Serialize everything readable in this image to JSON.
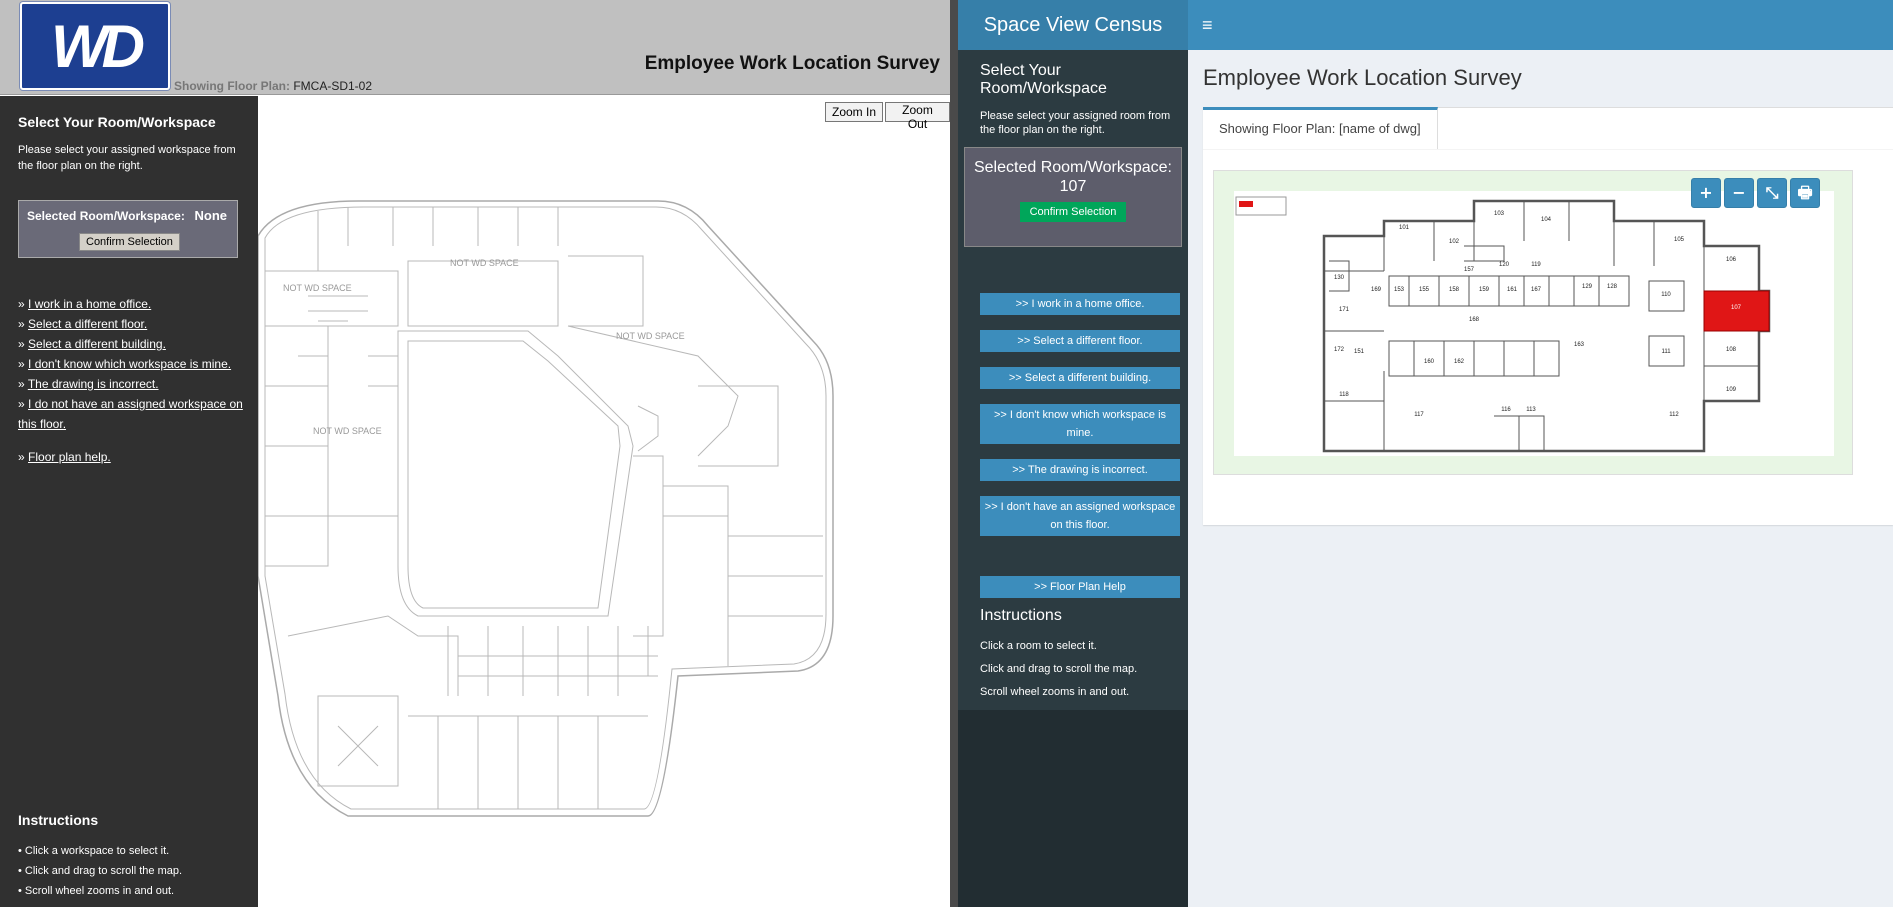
{
  "left": {
    "logo_text": "WD",
    "showing_label": "Showing Floor Plan:",
    "floor_plan_name": "FMCA-SD1-02",
    "title": "Employee Work Location Survey",
    "sidebar": {
      "heading": "Select Your Room/Workspace",
      "instruction": "Please select your assigned workspace from the floor plan on the right.",
      "selected_label": "Selected Room/Workspace:",
      "selected_value": "None",
      "confirm_label": "Confirm Selection",
      "bullet": "»",
      "links": [
        "I work in a home office.",
        "Select a different floor.",
        "Select a different building.",
        "I don't know which workspace is mine.",
        "The drawing is incorrect.",
        "I do not have an assigned workspace on this floor."
      ],
      "help_link": "Floor plan help.",
      "instructions_title": "Instructions",
      "instructions": [
        "• Click a workspace to select it.",
        "• Click and drag to scroll the map.",
        "• Scroll wheel zooms in and out."
      ]
    },
    "map": {
      "zoom_in_label": "Zoom In",
      "zoom_out_label": "Zoom Out",
      "space_labels": [
        "NOT WD SPACE",
        "NOT WD SPACE",
        "NOT WD SPACE",
        "NOT WD SPACE"
      ]
    }
  },
  "right": {
    "brand": "Space View Census",
    "menu_icon": "≡",
    "sidebar": {
      "heading": "Select Your Room/Workspace",
      "instruction": "Please select your assigned room from the floor plan on the right.",
      "selected_text": "Selected Room/Workspace: 107",
      "confirm_label": "Confirm Selection",
      "buttons": [
        ">> I work in a home office.",
        ">> Select a different floor.",
        ">> Select a different building.",
        ">> I don't know which workspace is mine.",
        ">> The drawing is incorrect.",
        ">> I don't have an assigned workspace on this floor."
      ],
      "help_button": ">> Floor Plan Help",
      "instructions_title": "Instructions",
      "instructions": [
        "Click a room to select it.",
        "Click and drag to scroll the map.",
        "Scroll wheel zooms in and out."
      ]
    },
    "page_title": "Employee Work Location Survey",
    "tab_label": "Showing Floor Plan: [name of dwg]",
    "map_controls": {
      "zoom_in_icon": "+",
      "zoom_out_icon": "−",
      "fit_icon": "⤡",
      "print_icon": "🖶"
    },
    "selected_room": "107",
    "highlight_color": "#e01616",
    "room_labels": [
      "101",
      "102",
      "103",
      "104",
      "105",
      "106",
      "107",
      "108",
      "109",
      "110",
      "111",
      "112",
      "113",
      "116",
      "117",
      "118",
      "119",
      "120",
      "128",
      "129",
      "130",
      "151",
      "153",
      "155",
      "157",
      "158",
      "159",
      "160",
      "161",
      "162",
      "163",
      "167",
      "168",
      "169",
      "171",
      "172"
    ]
  }
}
